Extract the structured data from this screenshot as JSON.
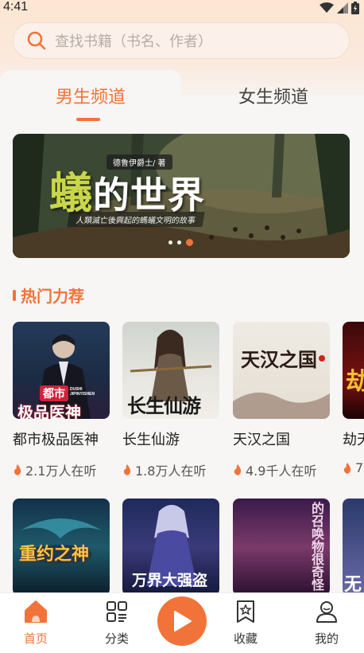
{
  "status": {
    "time": "4:41"
  },
  "search": {
    "placeholder": "查找书籍（书名、作者）"
  },
  "tabs": [
    {
      "label": "男生频道",
      "active": true
    },
    {
      "label": "女生频道",
      "active": false
    }
  ],
  "banner": {
    "author": "德鲁伊爵士/ 著",
    "title_first": "蟻",
    "title_rest": "的世界",
    "subtitle": "人類滅亡後興起的螞蟻文明的故事",
    "slides": 3,
    "active_slide": 3
  },
  "section": {
    "title": "热门力荐"
  },
  "books_row1": [
    {
      "title": "都市极品医神",
      "listeners": "2.1万人在听",
      "cover_text": "都市",
      "cover_text2": "极品医神",
      "cover_pinyin": "DUSHI JIPINYISHEN"
    },
    {
      "title": "长生仙游",
      "listeners": "1.8万人在听",
      "cover_text": "长生仙游"
    },
    {
      "title": "天汉之国",
      "listeners": "4.9千人在听",
      "cover_text": "天汉之国"
    },
    {
      "title": "劫天",
      "listeners": "7"
    }
  ],
  "books_row2": [
    {
      "cover_text": "重约之神"
    },
    {
      "cover_text": "万界大强盗"
    },
    {
      "cover_text": "的召唤物很奇怪"
    },
    {
      "cover_text": "无"
    }
  ],
  "nav": [
    {
      "label": "首页",
      "icon": "home-icon",
      "active": true
    },
    {
      "label": "分类",
      "icon": "category-icon",
      "active": false
    },
    {
      "label": "",
      "icon": "play-icon",
      "active": false
    },
    {
      "label": "收藏",
      "icon": "bookmark-icon",
      "active": false
    },
    {
      "label": "我的",
      "icon": "user-icon",
      "active": false
    }
  ],
  "colors": {
    "accent": "#f2733a",
    "background": "#f7f6f5"
  }
}
